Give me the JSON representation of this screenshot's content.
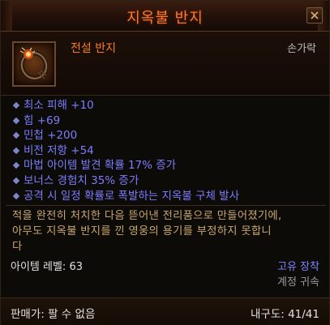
{
  "tooltip": {
    "title": "지옥불 반지",
    "rarity_type": "전설 반지",
    "slot": "손가락",
    "icon": "hellfire-ring-icon",
    "affixes": [
      "최소 피해 +10",
      "힘 +69",
      "민첩 +200",
      "비전 저항 +54",
      "마법 아이템 발견 확률 17% 증가",
      "보너스 경험치 35% 증가",
      "공격 시 일정 확률로 폭발하는 지옥불 구체 발사"
    ],
    "flavor_lines": [
      "적을 완전히 처치한 다음 뜯어낸 전리품으로 만들어졌기에,",
      "아무도 지옥불 반지를 낀 영웅의 용기를 부정하지 못합니",
      "다"
    ],
    "item_level_label": "아이템 레벨:",
    "item_level_value": "63",
    "unique_equipped": "고유 장착",
    "account_bound": "계정 귀속",
    "sell_price": "판매가: 팔 수 없음",
    "durability": "내구도: 41/41",
    "colors": {
      "legendary_orange": "#ff7a26",
      "affix_blue": "#7c7cff",
      "flavor_gold": "#c9a66b"
    }
  }
}
